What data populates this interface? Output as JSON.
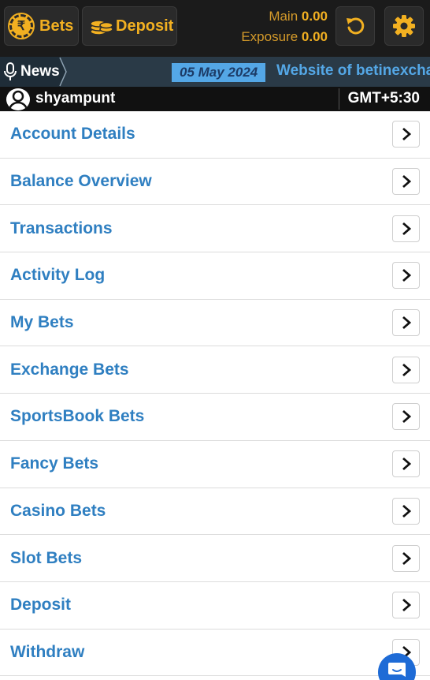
{
  "header": {
    "bets_label": "Bets",
    "bets_coin_symbol": "₹",
    "deposit_label": "Deposit",
    "main_label": "Main",
    "main_value": "0.00",
    "exposure_label": "Exposure",
    "exposure_value": "0.00",
    "icons": [
      "rupee-coin-icon",
      "coins-stack-icon",
      "refresh-icon",
      "gear-icon"
    ],
    "accent_color": "#f2b021"
  },
  "news": {
    "label": "News",
    "date": "05 May 2024",
    "text": "Website of betinexcha"
  },
  "user": {
    "name": "shyampunt",
    "timezone": "GMT+5:30"
  },
  "menu": {
    "items": [
      {
        "label": "Account Details"
      },
      {
        "label": "Balance Overview"
      },
      {
        "label": "Transactions"
      },
      {
        "label": "Activity Log"
      },
      {
        "label": "My Bets"
      },
      {
        "label": "Exchange Bets"
      },
      {
        "label": "SportsBook Bets"
      },
      {
        "label": "Fancy Bets"
      },
      {
        "label": "Casino Bets"
      },
      {
        "label": "Slot Bets"
      },
      {
        "label": "Deposit"
      },
      {
        "label": "Withdraw"
      }
    ],
    "label_color": "#2f7fc1"
  }
}
